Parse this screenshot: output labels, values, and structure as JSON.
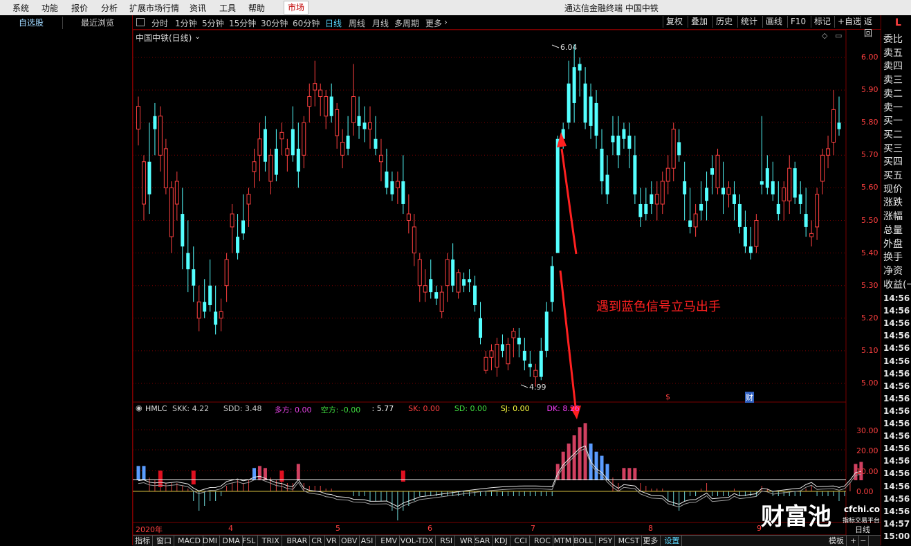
{
  "menu": {
    "items": [
      "系统",
      "功能",
      "报价",
      "分析",
      "扩展市场行情",
      "资讯",
      "工具",
      "帮助",
      "市场"
    ],
    "window_title": "通达信金融终端  中国中铁"
  },
  "left_tabs": {
    "watchlist": "自选股",
    "recent": "最近浏览"
  },
  "toolbar": {
    "periods": [
      "分时",
      "1分钟",
      "5分钟",
      "15分钟",
      "30分钟",
      "60分钟",
      "日线",
      "周线",
      "月线",
      "多周期",
      "更多"
    ],
    "active_period": "日线",
    "right_buttons": [
      "复权",
      "叠加",
      "历史",
      "统计",
      "画线",
      "F10",
      "标记",
      "+自选",
      "返回"
    ],
    "corner": "L"
  },
  "chart": {
    "title": "中国中铁(日线)",
    "high_label": "6.04",
    "low_label": "4.99",
    "annotation": "遇到蓝色信号立马出手",
    "event_markers": [
      "$",
      "财"
    ],
    "price_ticks": [
      "6.00",
      "5.90",
      "5.80",
      "5.70",
      "5.60",
      "5.50",
      "5.40",
      "5.30",
      "5.20",
      "5.10",
      "5.00"
    ],
    "x_labels": [
      "2020年",
      "4",
      "5",
      "6",
      "7",
      "8",
      "9"
    ],
    "period_label": "日线"
  },
  "indicator": {
    "name": "HMLC",
    "params": [
      {
        "text": "SKK: 4.22",
        "color": "#c8c8c8"
      },
      {
        "text": "SDD: 3.48",
        "color": "#c8c8c8"
      },
      {
        "text": "多方: 0.00",
        "color": "#e040e0"
      },
      {
        "text": "空方: -0.00",
        "color": "#40e040"
      },
      {
        "text": ": 5.77",
        "color": "#ffffff"
      },
      {
        "text": "SK: 0.00",
        "color": "#ff4040"
      },
      {
        "text": "SD: 0.00",
        "color": "#40e040"
      },
      {
        "text": "SJ: 0.00",
        "color": "#ffff40"
      },
      {
        "text": "DK: 8.26",
        "color": "#ff40ff"
      }
    ],
    "ticks": [
      "30.00",
      "20.00",
      "10.00",
      "0.00"
    ]
  },
  "right_panel": {
    "quote_labels": [
      "委比",
      "卖五",
      "卖四",
      "卖三",
      "卖二",
      "卖一",
      "买一",
      "买二",
      "买三",
      "买四",
      "买五",
      "现价",
      "涨跌",
      "涨幅",
      "总量",
      "外盘",
      "换手",
      "净资",
      "收益(一"
    ],
    "times": [
      "14:56",
      "14:56",
      "14:56",
      "14:56",
      "14:56",
      "14:56",
      "14:56",
      "14:56",
      "14:56",
      "14:56",
      "14:56",
      "14:56",
      "14:56",
      "14:56",
      "14:56",
      "14:56",
      "14:56",
      "14:56",
      "14:57",
      "15:00"
    ]
  },
  "bottom_tabs": [
    "指标",
    "窗口",
    "MACD",
    "DMI",
    "DMA",
    "FSL",
    "TRIX",
    "BRAR",
    "CR",
    "VR",
    "OBV",
    "ASI",
    "EMV",
    "VOL-TDX",
    "RSI",
    "WR",
    "SAR",
    "KDJ",
    "CCI",
    "ROC",
    "MTM",
    "BOLL",
    "PSY",
    "MCST",
    "更多",
    "设置",
    "模板",
    "+",
    "−"
  ],
  "watermark": {
    "brand": "财富池",
    "domain": "cfchi.com",
    "sub": "指标交易平台"
  },
  "colors": {
    "up": "#ff4040",
    "down": "#54ffff",
    "grid": "#7a0000",
    "signal_blue": "#5a9cff",
    "signal_red": "#d04060"
  },
  "chart_data": {
    "type": "candlestick",
    "ylim": [
      4.95,
      6.08
    ],
    "candles": [
      [
        5.78,
        5.88,
        5.73,
        5.85
      ],
      [
        5.55,
        5.7,
        5.5,
        5.68
      ],
      [
        5.68,
        5.8,
        5.52,
        5.58
      ],
      [
        5.82,
        5.86,
        5.7,
        5.78
      ],
      [
        5.7,
        5.85,
        5.65,
        5.82
      ],
      [
        5.6,
        5.75,
        5.58,
        5.72
      ],
      [
        5.45,
        5.62,
        5.4,
        5.6
      ],
      [
        5.55,
        5.65,
        5.5,
        5.62
      ],
      [
        5.52,
        5.6,
        5.35,
        5.42
      ],
      [
        5.4,
        5.5,
        5.28,
        5.35
      ],
      [
        5.35,
        5.42,
        5.25,
        5.3
      ],
      [
        5.2,
        5.3,
        5.16,
        5.25
      ],
      [
        5.25,
        5.32,
        5.2,
        5.22
      ],
      [
        5.3,
        5.38,
        5.22,
        5.24
      ],
      [
        5.22,
        5.3,
        5.15,
        5.18
      ],
      [
        5.2,
        5.26,
        5.16,
        5.22
      ],
      [
        5.3,
        5.4,
        5.25,
        5.38
      ],
      [
        5.48,
        5.55,
        5.4,
        5.52
      ],
      [
        5.45,
        5.52,
        5.38,
        5.4
      ],
      [
        5.5,
        5.58,
        5.44,
        5.46
      ],
      [
        5.55,
        5.6,
        5.48,
        5.58
      ],
      [
        5.65,
        5.72,
        5.6,
        5.68
      ],
      [
        5.7,
        5.8,
        5.62,
        5.75
      ],
      [
        5.78,
        5.82,
        5.65,
        5.68
      ],
      [
        5.62,
        5.72,
        5.58,
        5.7
      ],
      [
        5.72,
        5.78,
        5.62,
        5.64
      ],
      [
        5.75,
        5.8,
        5.7,
        5.77
      ],
      [
        5.7,
        5.75,
        5.65,
        5.72
      ],
      [
        5.78,
        5.85,
        5.68,
        5.7
      ],
      [
        5.72,
        5.8,
        5.6,
        5.65
      ],
      [
        5.7,
        5.82,
        5.66,
        5.8
      ],
      [
        5.85,
        5.92,
        5.8,
        5.88
      ],
      [
        5.9,
        5.99,
        5.85,
        5.92
      ],
      [
        5.88,
        5.92,
        5.82,
        5.9
      ],
      [
        5.82,
        5.9,
        5.78,
        5.88
      ],
      [
        5.88,
        5.92,
        5.8,
        5.82
      ],
      [
        5.76,
        5.86,
        5.72,
        5.84
      ],
      [
        5.7,
        5.78,
        5.66,
        5.74
      ],
      [
        5.76,
        5.82,
        5.7,
        5.72
      ],
      [
        5.8,
        5.98,
        5.76,
        5.88
      ],
      [
        5.82,
        5.88,
        5.75,
        5.79
      ],
      [
        5.8,
        5.85,
        5.74,
        5.78
      ],
      [
        5.78,
        5.85,
        5.72,
        5.8
      ],
      [
        5.75,
        5.82,
        5.7,
        5.72
      ],
      [
        5.68,
        5.75,
        5.62,
        5.7
      ],
      [
        5.65,
        5.72,
        5.58,
        5.6
      ],
      [
        5.62,
        5.65,
        5.56,
        5.58
      ],
      [
        5.6,
        5.65,
        5.55,
        5.62
      ],
      [
        5.62,
        5.7,
        5.52,
        5.55
      ],
      [
        5.5,
        5.58,
        5.46,
        5.52
      ],
      [
        5.4,
        5.52,
        5.36,
        5.48
      ],
      [
        5.3,
        5.4,
        5.25,
        5.38
      ],
      [
        5.28,
        5.35,
        5.25,
        5.3
      ],
      [
        5.32,
        5.38,
        5.26,
        5.28
      ],
      [
        5.28,
        5.3,
        5.24,
        5.26
      ],
      [
        5.22,
        5.3,
        5.2,
        5.28
      ],
      [
        5.3,
        5.4,
        5.25,
        5.38
      ],
      [
        5.38,
        5.43,
        5.28,
        5.3
      ],
      [
        5.28,
        5.35,
        5.26,
        5.34
      ],
      [
        5.32,
        5.34,
        5.28,
        5.3
      ],
      [
        5.32,
        5.35,
        5.28,
        5.31
      ],
      [
        5.3,
        5.33,
        5.22,
        5.24
      ],
      [
        5.2,
        5.25,
        5.12,
        5.14
      ],
      [
        5.04,
        5.1,
        5.03,
        5.08
      ],
      [
        5.08,
        5.12,
        5.04,
        5.1
      ],
      [
        5.05,
        5.14,
        5.02,
        5.12
      ],
      [
        5.12,
        5.15,
        5.08,
        5.1
      ],
      [
        5.06,
        5.14,
        5.04,
        5.12
      ],
      [
        5.14,
        5.17,
        5.08,
        5.16
      ],
      [
        5.14,
        5.17,
        5.08,
        5.12
      ],
      [
        5.1,
        5.14,
        5.04,
        5.07
      ],
      [
        5.06,
        5.1,
        5.02,
        5.05
      ],
      [
        5.02,
        5.06,
        4.99,
        5.04
      ],
      [
        5.1,
        5.14,
        5.01,
        5.02
      ],
      [
        5.22,
        5.25,
        5.08,
        5.1
      ],
      [
        5.36,
        5.39,
        5.22,
        5.25
      ],
      [
        5.75,
        5.76,
        5.4,
        5.4
      ],
      [
        5.78,
        5.8,
        5.72,
        5.75
      ],
      [
        5.92,
        5.99,
        5.78,
        5.8
      ],
      [
        5.97,
        6.04,
        5.8,
        5.86
      ],
      [
        5.98,
        6.0,
        5.88,
        5.96
      ],
      [
        5.92,
        5.97,
        5.78,
        5.8
      ],
      [
        5.88,
        5.92,
        5.75,
        5.79
      ],
      [
        5.86,
        5.9,
        5.72,
        5.76
      ],
      [
        5.72,
        5.78,
        5.58,
        5.62
      ],
      [
        5.64,
        5.7,
        5.55,
        5.58
      ],
      [
        5.76,
        5.82,
        5.7,
        5.74
      ],
      [
        5.76,
        5.82,
        5.66,
        5.7
      ],
      [
        5.78,
        5.8,
        5.72,
        5.75
      ],
      [
        5.76,
        5.8,
        5.66,
        5.72
      ],
      [
        5.7,
        5.76,
        5.55,
        5.58
      ],
      [
        5.55,
        5.6,
        5.48,
        5.51
      ],
      [
        5.55,
        5.6,
        5.5,
        5.52
      ],
      [
        5.58,
        5.62,
        5.52,
        5.55
      ],
      [
        5.55,
        5.62,
        5.5,
        5.58
      ],
      [
        5.55,
        5.65,
        5.52,
        5.62
      ],
      [
        5.62,
        5.7,
        5.58,
        5.66
      ],
      [
        5.66,
        5.8,
        5.62,
        5.78
      ],
      [
        5.74,
        5.78,
        5.68,
        5.7
      ],
      [
        5.62,
        5.68,
        5.5,
        5.58
      ],
      [
        5.5,
        5.6,
        5.46,
        5.48
      ],
      [
        5.48,
        5.55,
        5.45,
        5.52
      ],
      [
        5.55,
        5.62,
        5.5,
        5.53
      ],
      [
        5.6,
        5.65,
        5.5,
        5.56
      ],
      [
        5.66,
        5.7,
        5.58,
        5.64
      ],
      [
        5.6,
        5.72,
        5.58,
        5.7
      ],
      [
        5.6,
        5.68,
        5.52,
        5.58
      ],
      [
        5.58,
        5.62,
        5.54,
        5.6
      ],
      [
        5.58,
        5.62,
        5.5,
        5.55
      ],
      [
        5.55,
        5.58,
        5.46,
        5.48
      ],
      [
        5.48,
        5.53,
        5.4,
        5.42
      ],
      [
        5.42,
        5.48,
        5.38,
        5.4
      ],
      [
        5.42,
        5.52,
        5.4,
        5.5
      ],
      [
        5.62,
        5.82,
        5.58,
        5.61
      ],
      [
        5.66,
        5.7,
        5.58,
        5.6
      ],
      [
        5.62,
        5.68,
        5.56,
        5.58
      ],
      [
        5.55,
        5.62,
        5.5,
        5.52
      ],
      [
        5.56,
        5.62,
        5.5,
        5.6
      ],
      [
        5.56,
        5.7,
        5.52,
        5.66
      ],
      [
        5.66,
        5.68,
        5.55,
        5.57
      ],
      [
        5.58,
        5.62,
        5.52,
        5.55
      ],
      [
        5.52,
        5.6,
        5.45,
        5.48
      ],
      [
        5.45,
        5.5,
        5.42,
        5.46
      ],
      [
        5.48,
        5.6,
        5.44,
        5.58
      ],
      [
        5.62,
        5.72,
        5.58,
        5.7
      ],
      [
        5.7,
        5.76,
        5.66,
        5.72
      ],
      [
        5.74,
        5.9,
        5.7,
        5.84
      ],
      [
        5.8,
        5.88,
        5.76,
        5.78
      ]
    ],
    "hist": [
      7,
      7,
      5,
      4,
      4,
      3,
      3,
      3,
      2,
      1,
      -2,
      -4,
      -3,
      -2,
      -2,
      -1,
      2,
      3,
      4,
      3,
      4,
      6,
      7,
      6,
      5,
      4,
      4,
      3,
      3,
      8,
      3,
      2,
      2,
      2,
      1,
      1,
      0,
      0,
      0,
      -1,
      -1,
      -1,
      -2,
      -2,
      -2,
      -2,
      -4,
      -6,
      -4,
      -3,
      -2,
      -1,
      -1,
      -1,
      -1,
      -1,
      -1,
      -1,
      -1,
      -1,
      -1,
      -1,
      -1,
      -1,
      -1,
      -1,
      -1,
      -1,
      -1,
      -1,
      -1,
      -1,
      -1,
      -1,
      -1,
      -1,
      8,
      14,
      18,
      22,
      26,
      28,
      18,
      14,
      12,
      8,
      5,
      3,
      6,
      6,
      6,
      3,
      2,
      1,
      1,
      1,
      -2,
      -3,
      -4,
      -2,
      -1,
      -1,
      1,
      3,
      -1,
      -1,
      -1,
      -1,
      1,
      -1,
      -1,
      -1,
      -1,
      2,
      1,
      -1,
      -1,
      -1,
      -1,
      -1,
      -1,
      1,
      2,
      -1,
      -1,
      -1,
      -1,
      -2,
      -1,
      3,
      8,
      9
    ],
    "hist_colors": [
      "b",
      "b",
      "b",
      "b",
      "b",
      "b",
      "b",
      "b",
      "r",
      "r",
      "r",
      "r",
      "r",
      "r",
      "r",
      "r",
      "r",
      "r",
      "b",
      "b",
      "b",
      "b",
      "r",
      "r",
      "r",
      "r",
      "r",
      "r",
      "r",
      "r",
      "r",
      "r",
      "r",
      "r",
      "r",
      "r",
      "r",
      "r",
      "r",
      "r",
      "r",
      "r",
      "r",
      "r",
      "r",
      "r",
      "r",
      "r",
      "r",
      "r",
      "r",
      "r",
      "r",
      "r",
      "r",
      "r",
      "r",
      "r",
      "r",
      "r",
      "r",
      "r",
      "r",
      "r",
      "r",
      "r",
      "r",
      "r",
      "r",
      "r",
      "r",
      "r",
      "r",
      "r",
      "r",
      "r",
      "r",
      "r",
      "r",
      "r",
      "r",
      "r",
      "b",
      "b",
      "b",
      "b",
      "b",
      "b",
      "r",
      "r",
      "r",
      "r",
      "r",
      "r",
      "r",
      "r",
      "r",
      "r",
      "r",
      "r",
      "r",
      "r",
      "r",
      "r",
      "r",
      "r",
      "r",
      "r",
      "r",
      "r",
      "r",
      "r",
      "r",
      "r",
      "r",
      "r",
      "r",
      "r",
      "r",
      "r",
      "r",
      "r",
      "r",
      "r",
      "r",
      "r",
      "r",
      "r",
      "r",
      "r"
    ]
  }
}
